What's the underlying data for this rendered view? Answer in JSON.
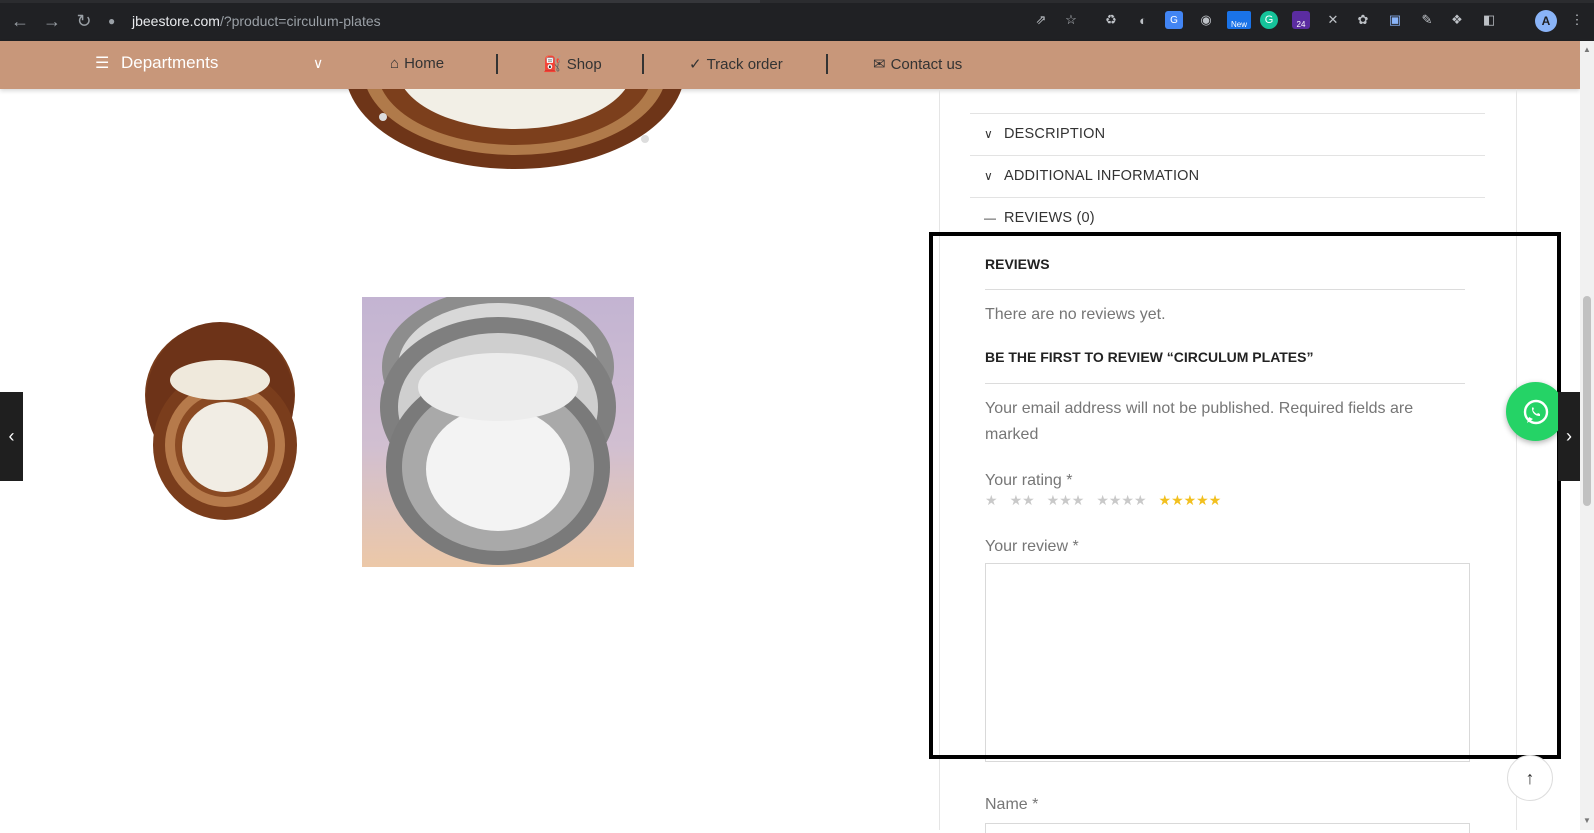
{
  "browser": {
    "url_host": "jbeestore.com",
    "url_path": "/?product=circulum-plates",
    "ext_new_badge": "New",
    "ext_count_badge": "24",
    "profile_initial": "A"
  },
  "nav": {
    "departments": "Departments",
    "home": "Home",
    "shop": "Shop",
    "track": "Track order",
    "contact": "Contact us"
  },
  "tabs": {
    "description": "DESCRIPTION",
    "additional": "ADDITIONAL INFORMATION",
    "reviews": "REVIEWS (0)"
  },
  "reviews": {
    "title": "REVIEWS",
    "empty": "There are no reviews yet.",
    "form_title": "BE THE FIRST TO REVIEW “CIRCULUM PLATES”",
    "notes": "Your email address will not be published. Required fields are marked",
    "rating_label": "Your rating *",
    "review_label": "Your review *",
    "name_label": "Name *",
    "stars": [
      "★",
      "★★",
      "★★★",
      "★★★★",
      "★★★★★"
    ],
    "selected_rating": 5
  },
  "colors": {
    "nav_bg": "#c8977a",
    "star_active": "#f2c01f",
    "whatsapp": "#25d366"
  }
}
